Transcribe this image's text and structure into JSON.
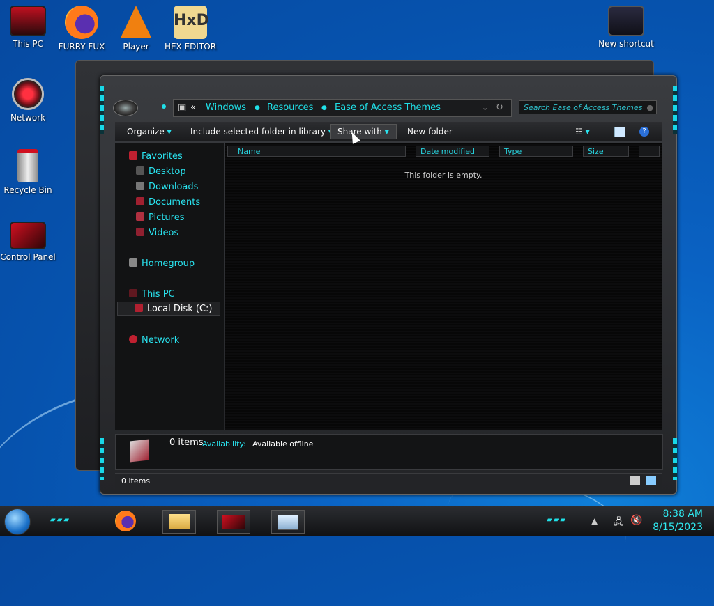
{
  "desktop": {
    "icons": [
      {
        "label": "This PC"
      },
      {
        "label": "FURRY FUX"
      },
      {
        "label": "Player"
      },
      {
        "label": "HEX EDITOR"
      },
      {
        "label": "New shortcut"
      },
      {
        "label": "Network"
      },
      {
        "label": "Recycle Bin"
      },
      {
        "label": "Control Panel"
      }
    ]
  },
  "explorer": {
    "breadcrumb": [
      "Windows",
      "Resources",
      "Ease of Access Themes"
    ],
    "search_placeholder": "Search Ease of Access Themes",
    "toolbar": {
      "organize": "Organize",
      "include": "Include selected folder in library",
      "share": "Share with",
      "new_folder": "New folder"
    },
    "nav": {
      "favorites": "Favorites",
      "desktop": "Desktop",
      "downloads": "Downloads",
      "documents": "Documents",
      "pictures": "Pictures",
      "videos": "Videos",
      "homegroup": "Homegroup",
      "this_pc": "This PC",
      "local_disk": "Local Disk (C:)",
      "network": "Network"
    },
    "columns": [
      "Name",
      "Date modified",
      "Type",
      "Size"
    ],
    "empty_text": "This folder is empty.",
    "details": {
      "count": "0 items",
      "availability_label": "Availability:",
      "availability_value": "Available offline"
    },
    "status": "0 items"
  },
  "taskbar": {
    "time": "8:38 AM",
    "date": "8/15/2023"
  },
  "colors": {
    "accent": "#20e0e8",
    "desktop": "#0a62c3"
  }
}
